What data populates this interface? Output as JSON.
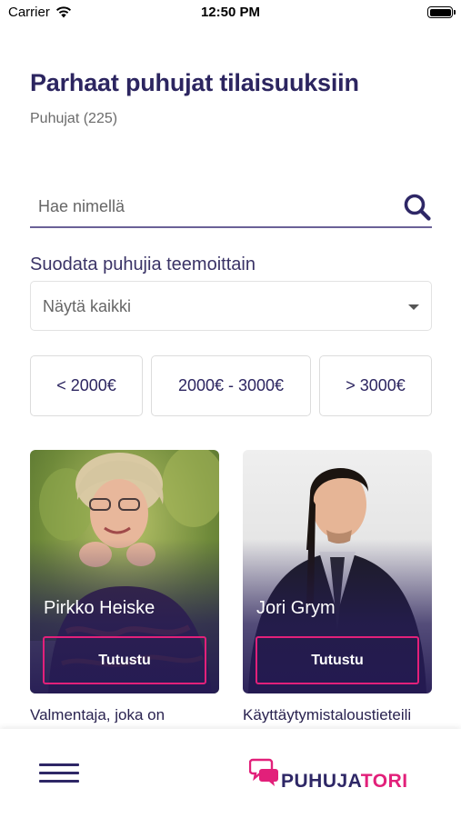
{
  "status": {
    "carrier": "Carrier",
    "time": "12:50 PM"
  },
  "header": {
    "title": "Parhaat puhujat tilaisuuksiin",
    "count_label": "Puhujat (225)"
  },
  "search": {
    "placeholder": "Hae nimellä",
    "icon": "search-icon"
  },
  "filter": {
    "label": "Suodata puhujia teemoittain",
    "selected": "Näytä kaikki"
  },
  "price_filters": [
    {
      "label": "< 2000€"
    },
    {
      "label": "2000€ - 3000€"
    },
    {
      "label": "> 3000€"
    }
  ],
  "speakers": [
    {
      "name": "Pirkko Heiske",
      "button": "Tutustu",
      "description": "Valmentaja, joka on"
    },
    {
      "name": "Jori Grym",
      "button": "Tutustu",
      "description": "Käyttäytymistaloustieteili"
    }
  ],
  "bottom_nav": {
    "menu_icon": "hamburger-menu-icon",
    "logo_part1": "PUHUJA",
    "logo_part2": "TORI"
  },
  "colors": {
    "brand_navy": "#2e2766",
    "brand_pink": "#e2207a"
  }
}
